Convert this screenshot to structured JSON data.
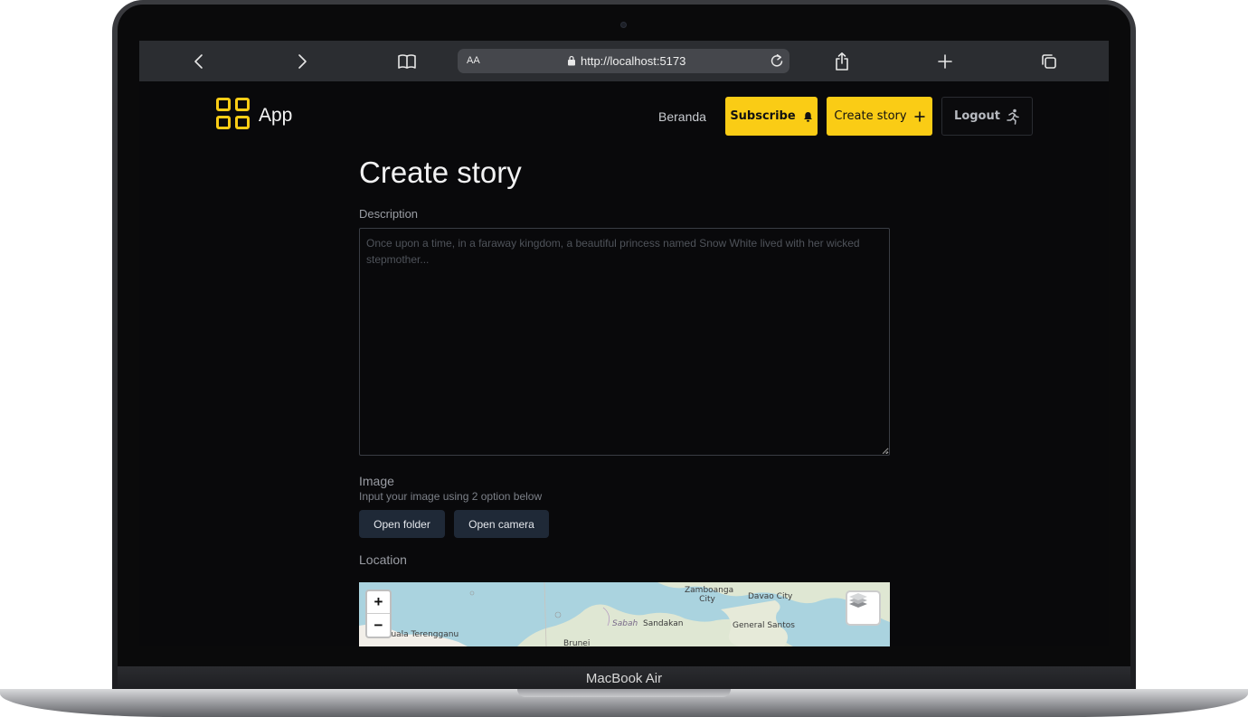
{
  "device": {
    "label": "MacBook Air"
  },
  "browser": {
    "text_size_label": "AA",
    "url": "http://localhost:5173"
  },
  "app": {
    "logo_text": "App",
    "nav": {
      "home_link": "Beranda",
      "subscribe_button": "Subscribe",
      "create_story_button": "Create story",
      "logout_button": "Logout"
    },
    "accent_color": "#facc15"
  },
  "form": {
    "title": "Create story",
    "description_label": "Description",
    "description_placeholder": "Once upon a time, in a faraway kingdom, a beautiful princess named Snow White lived with her wicked stepmother...",
    "image_label": "Image",
    "image_help": "Input your image using 2 option below",
    "open_folder_button": "Open folder",
    "open_camera_button": "Open camera",
    "location_label": "Location"
  },
  "map": {
    "zoom_in": "+",
    "zoom_out": "−",
    "place_labels": {
      "kuala_terengganu": "Kuala Terengganu",
      "zamboanga_city": "Zamboanga City",
      "davao_city": "Davao City",
      "sabah": "Sabah",
      "sandakan": "Sandakan",
      "general_santos": "General Santos",
      "brunei": "Brunei"
    }
  }
}
